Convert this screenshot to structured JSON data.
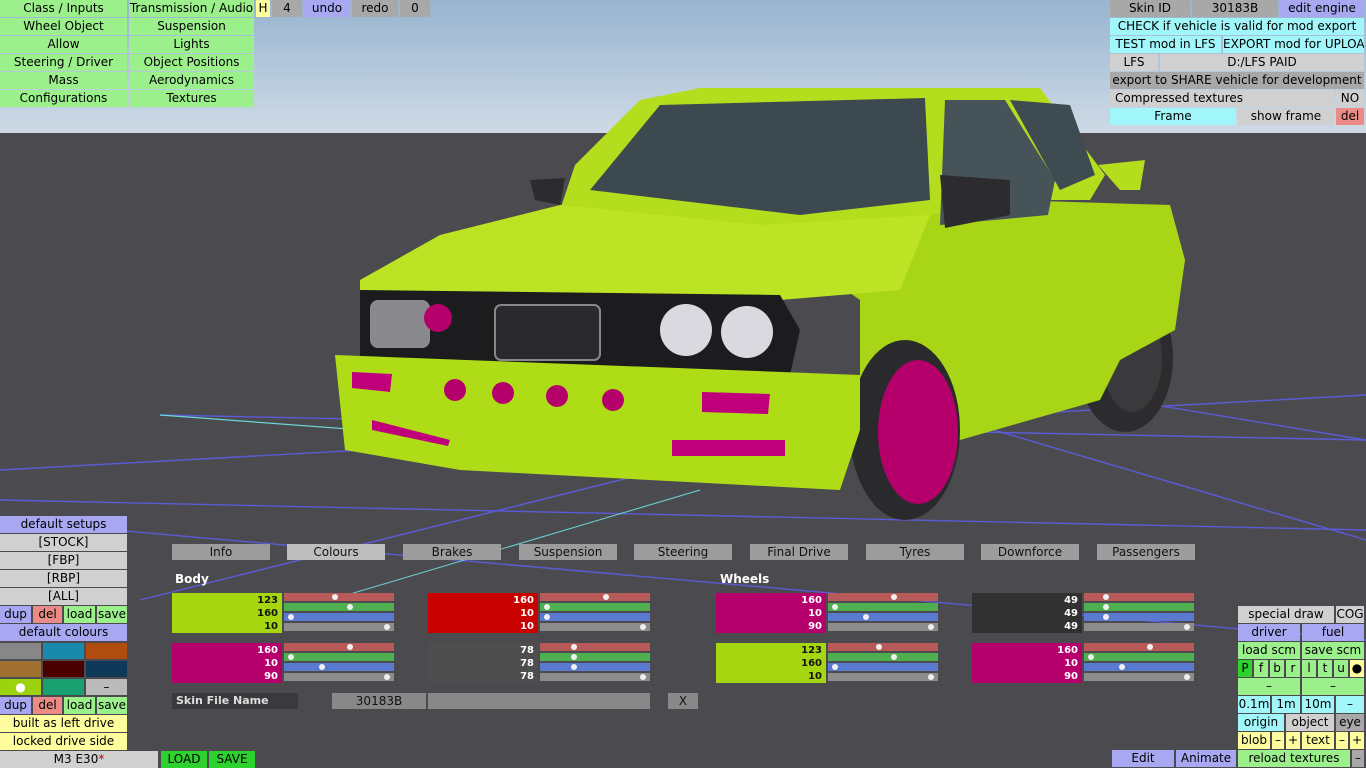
{
  "colors": {
    "body": "#a6d60f",
    "pink": "#b5006c",
    "red": "#c80000",
    "grey": "#4e4e4e",
    "dark": "#313131"
  },
  "top_left": {
    "rows": [
      {
        "left": "Class / Inputs",
        "right": "Transmission / Audio"
      },
      {
        "left": "Wheel Object",
        "right": "Suspension"
      },
      {
        "left": "Allow",
        "right": "Lights"
      },
      {
        "left": "Steering / Driver",
        "right": "Object Positions"
      },
      {
        "left": "Mass",
        "right": "Aerodynamics"
      },
      {
        "left": "Configurations",
        "right": "Textures"
      }
    ],
    "h_label": "H",
    "num": "4",
    "undo": "undo",
    "redo": "redo",
    "zero": "0"
  },
  "top_right": {
    "skin_id_label": "Skin ID",
    "skin_id": "30183B",
    "edit_engine": "edit engine",
    "check": "CHECK if vehicle is valid for mod export",
    "test": "TEST mod in LFS",
    "export": "EXPORT mod for UPLOAD",
    "lfs": "LFS",
    "path": "D:/LFS PAID",
    "share": "export to SHARE vehicle for development",
    "compressed": "Compressed textures",
    "compressed_val": "NO",
    "frame": "Frame",
    "show_frame": "show frame",
    "del": "del"
  },
  "left_panel": {
    "default_setups": "default setups",
    "setups": [
      "[STOCK]",
      "[FBP]",
      "[RBP]",
      "[ALL]"
    ],
    "dup": "dup",
    "del": "del",
    "load": "load",
    "save": "save",
    "default_colours": "default colours",
    "palette": [
      "#878787",
      "#1a8aac",
      "#ae4d0e",
      "#a07030",
      "#4a0000",
      "#103858",
      "#9cd20e",
      "#18a070",
      "#bbbbbb"
    ],
    "dot": "●",
    "dash": "–",
    "built": "built as left drive",
    "locked": "locked drive side",
    "car_name": "M3 E30",
    "asterisk": "*",
    "load_btn": "LOAD",
    "save_btn": "SAVE"
  },
  "tabs": [
    "Info",
    "Colours",
    "Brakes",
    "Suspension",
    "Steering",
    "Final Drive",
    "Tyres",
    "Downforce",
    "Passengers"
  ],
  "colours": {
    "body_label": "Body",
    "wheels_label": "Wheels",
    "swatches": [
      {
        "hex": "#a6d60f",
        "r": "123",
        "g": "160",
        "b": "10"
      },
      {
        "hex": "#c80000",
        "r": "160",
        "g": "10",
        "b": "10"
      },
      {
        "hex": "#b5006c",
        "r": "160",
        "g": "10",
        "b": "90"
      },
      {
        "hex": "#313131",
        "r": "49",
        "g": "49",
        "b": "49"
      },
      {
        "hex": "#b5006c",
        "r": "160",
        "g": "10",
        "b": "90"
      },
      {
        "hex": "#4e4e4e",
        "r": "78",
        "g": "78",
        "b": "78"
      },
      {
        "hex": "#a6d60f",
        "r": "123",
        "g": "160",
        "b": "10"
      },
      {
        "hex": "#b5006c",
        "r": "160",
        "g": "10",
        "b": "90"
      }
    ],
    "skin_file_label": "Skin File Name",
    "skin_file": "30183B",
    "x": "X"
  },
  "bottom_right": {
    "special_draw": "special draw",
    "cog": "COG",
    "driver": "driver",
    "fuel": "fuel",
    "load_scm": "load scm",
    "save_scm": "save scm",
    "flags": [
      "P",
      "f",
      "b",
      "r",
      "l",
      "t",
      "u",
      "●"
    ],
    "dash": "–",
    "d01": "0.1m",
    "d1": "1m",
    "d10": "10m",
    "origin": "origin",
    "object": "object",
    "eye": "eye",
    "blob": "blob",
    "minus": "–",
    "plus": "+",
    "text": "text",
    "reload": "reload textures"
  },
  "bottom": {
    "edit": "Edit",
    "animate": "Animate"
  }
}
